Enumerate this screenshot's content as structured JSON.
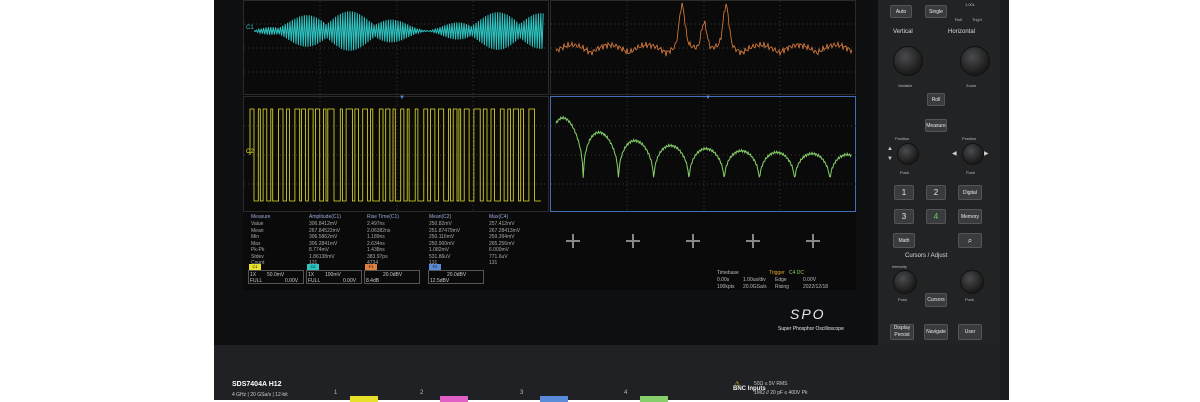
{
  "colors": {
    "ch1": "#2ec4c1",
    "ch2": "#e8e12a",
    "fft": "#e0803f",
    "ch4": "#86d06a",
    "bezel": "#0e0f10",
    "panel": "#222325",
    "accent_green": "#5fd35a"
  },
  "measurements": {
    "headers": [
      "Measure",
      "Amplitude(C1)",
      "Rise Time(C1)",
      "Mean(C2)",
      "Max(C4)"
    ],
    "rows": [
      [
        "Value",
        "306.8412mV",
        "2.497ns",
        "250.82mV",
        "257.412mV"
      ],
      [
        "Mean",
        "267.84522mV",
        "2.06382ns",
        "251.87479mV",
        "267.28413mV"
      ],
      [
        "Min",
        "306.5862mV",
        "1.189ns",
        "250.116mV",
        "259.394mV"
      ],
      [
        "Max",
        "306.2841mV",
        "2.634ns",
        "250.900mV",
        "265.256mV"
      ],
      [
        "Pk-Pk",
        "8.774mV",
        "1.438ns",
        "1.082mV",
        "6.000mV"
      ],
      [
        "Stdev",
        "1.86138mV",
        "383.97ps",
        "531.86uV",
        "771.6uV"
      ],
      [
        "Count",
        "131",
        "4734",
        "131",
        "131"
      ]
    ]
  },
  "channel_boxes": [
    {
      "label": "1X",
      "v1": "50.0mV",
      "v2": "FULL",
      "v3": "0.00V",
      "badge": "C1"
    },
    {
      "label": "1X",
      "v1": "100mV",
      "v2": "FULL",
      "v3": "0.00V",
      "badge": "C2"
    },
    {
      "label": "",
      "v1": "20.0dBV",
      "v2": "8.4dB",
      "v3": "",
      "badge": "F1"
    },
    {
      "label": "",
      "v1": "20.0dBV",
      "v2": "12.5dBV",
      "v3": "",
      "badge": "F2"
    }
  ],
  "timebase": {
    "labels": [
      "Timebase",
      "Trigger"
    ],
    "line1": [
      "0.00s",
      "1.00us/div",
      "C4 DC",
      "0.00V"
    ],
    "line2": [
      "100kpts",
      "20.0GSa/s",
      "Edge",
      "Rising"
    ],
    "date": "2022/12/18"
  },
  "branding": {
    "logo": "SPO",
    "tagline": "Super Phosphor Oscilloscope"
  },
  "panel": {
    "top_buttons": [
      "Auto",
      "Single"
    ],
    "mode_labels": [
      "Roll",
      "Trig'd"
    ],
    "top_right": "1.00L",
    "sections": [
      "Vertical",
      "Horizontal",
      "Cursors / Adjust"
    ],
    "small_labels": [
      "Variable",
      "Zoom",
      "Position",
      "Position",
      "Push",
      "Push",
      "Intensity",
      "Push",
      "Push"
    ],
    "mid_buttons": [
      "Roll",
      "Measure"
    ],
    "channel_buttons": [
      "1",
      "2",
      "Digital",
      "3",
      "4",
      "Memory",
      "Math",
      "Search"
    ],
    "cursor_buttons": [
      "Cursors"
    ],
    "bottom_buttons": [
      "Display Persist",
      "Navigate",
      "User"
    ]
  },
  "bottom": {
    "model": "SDS7404A  H12",
    "spec": "4 GHz  |  20 GSa/s  |  12-bit",
    "channel_numbers": [
      "1",
      "2",
      "3",
      "4"
    ],
    "bnc_title": "BNC Inputs",
    "bnc_line1": "50Ω ≤ 5V RMS",
    "bnc_line2": "1MΩ // 20 pF ≤ 400V Pk"
  }
}
